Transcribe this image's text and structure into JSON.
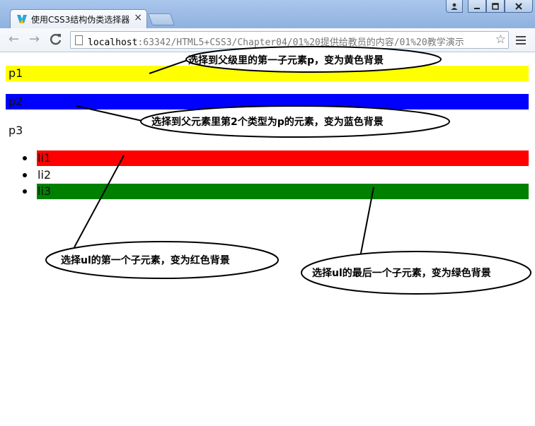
{
  "browser": {
    "tab_title": "使用CSS3结构伪类选择器",
    "tab_close": "×",
    "url_host": "localhost",
    "url_rest": ":63342/HTML5+CSS3/Chapter04/01%20提供给教员的内容/01%20教学演示",
    "back_glyph": "←",
    "forward_glyph": "→",
    "reload_glyph": "C",
    "star_glyph": "☆"
  },
  "page": {
    "paragraphs": [
      {
        "text": "p1",
        "background": "#ffff00"
      },
      {
        "text": "p2",
        "background": "#0000ff"
      },
      {
        "text": "p3",
        "background": "#ffffff"
      }
    ],
    "list_items": [
      {
        "text": "li1",
        "background": "#ff0000"
      },
      {
        "text": "li2",
        "background": "#ffffff"
      },
      {
        "text": "li3",
        "background": "#008000"
      }
    ]
  },
  "annotations": [
    {
      "text": "选择到父级里的第一子元素p，变为黄色背景"
    },
    {
      "text": "选择到父元素里第2个类型为p的元素，变为蓝色背景"
    },
    {
      "text": "选择ul的第一个子元素，变为红色背景"
    },
    {
      "text": "选择ul的最后一个子元素，变为绿色背景"
    }
  ],
  "colors": {
    "yellow": "#ffff00",
    "blue": "#0000ff",
    "red": "#ff0000",
    "green": "#008000"
  }
}
